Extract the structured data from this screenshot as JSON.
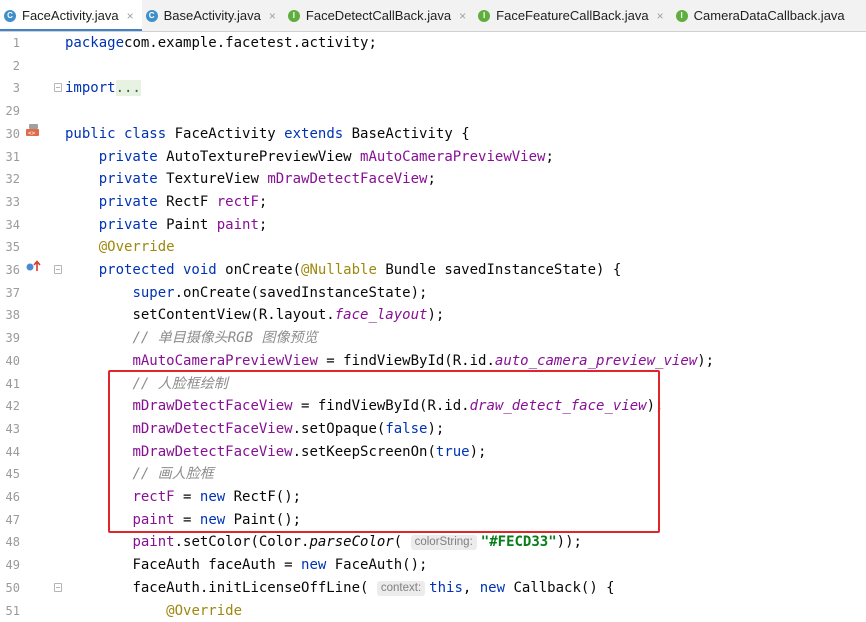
{
  "tabs": [
    {
      "label": "FaceActivity.java",
      "icon": "class-icon",
      "active": true,
      "close": "×"
    },
    {
      "label": "BaseActivity.java",
      "icon": "class-icon",
      "active": false,
      "close": "×"
    },
    {
      "label": "FaceDetectCallBack.java",
      "icon": "interface-icon",
      "active": false,
      "close": "×"
    },
    {
      "label": "FaceFeatureCallBack.java",
      "icon": "interface-icon",
      "active": false,
      "close": "×"
    },
    {
      "label": "CameraDataCallback.java",
      "icon": "interface-icon",
      "active": false,
      "close": ""
    }
  ],
  "tab_icon_letters": {
    "class": "C",
    "interface": "I"
  },
  "line_numbers": [
    "1",
    "2",
    "3",
    "29",
    "30",
    "31",
    "32",
    "33",
    "34",
    "35",
    "36",
    "37",
    "38",
    "39",
    "40",
    "41",
    "42",
    "43",
    "44",
    "45",
    "46",
    "47",
    "48",
    "49",
    "50",
    "51"
  ],
  "code_lines": [
    [
      [
        "kw",
        "package"
      ],
      [
        "",
        "com.example.facetest.activity;"
      ]
    ],
    [],
    [
      [
        "kw",
        "import"
      ],
      [
        "",
        ""
      ],
      [
        "fold-dots",
        "..."
      ]
    ],
    [],
    [
      [
        "kw",
        "public class"
      ],
      [
        "",
        " FaceActivity "
      ],
      [
        "kw",
        "extends"
      ],
      [
        "",
        " BaseActivity {"
      ]
    ],
    [
      [
        "",
        "    "
      ],
      [
        "kw",
        "private"
      ],
      [
        "",
        " AutoTexturePreviewView "
      ],
      [
        "fld",
        "mAutoCameraPreviewView"
      ],
      [
        "",
        ";"
      ]
    ],
    [
      [
        "",
        "    "
      ],
      [
        "kw",
        "private"
      ],
      [
        "",
        " TextureView "
      ],
      [
        "fld",
        "mDrawDetectFaceView"
      ],
      [
        "",
        ";"
      ]
    ],
    [
      [
        "",
        "    "
      ],
      [
        "kw",
        "private"
      ],
      [
        "",
        " RectF "
      ],
      [
        "fld",
        "rectF"
      ],
      [
        "",
        ";"
      ]
    ],
    [
      [
        "",
        "    "
      ],
      [
        "kw",
        "private"
      ],
      [
        "",
        " Paint "
      ],
      [
        "fld",
        "paint"
      ],
      [
        "",
        ";"
      ]
    ],
    [
      [
        "",
        "    "
      ],
      [
        "ann",
        "@Override"
      ]
    ],
    [
      [
        "",
        "    "
      ],
      [
        "kw",
        "protected void"
      ],
      [
        "",
        " onCreate("
      ],
      [
        "ann",
        "@Nullable"
      ],
      [
        "",
        " Bundle savedInstanceState) {"
      ]
    ],
    [
      [
        "",
        "        "
      ],
      [
        "kw",
        "super"
      ],
      [
        "",
        ".onCreate(savedInstanceState);"
      ]
    ],
    [
      [
        "",
        "        "
      ],
      [
        "",
        "setContentView(R.layout."
      ],
      [
        "ifld",
        "face_layout"
      ],
      [
        "",
        ");"
      ]
    ],
    [
      [
        "",
        "        "
      ],
      [
        "cmt",
        "// 单目摄像头RGB 图像预览"
      ]
    ],
    [
      [
        "",
        "        "
      ],
      [
        "fld",
        "mAutoCameraPreviewView"
      ],
      [
        "",
        " = findViewById(R.id."
      ],
      [
        "ifld",
        "auto_camera_preview_view"
      ],
      [
        "",
        ");"
      ]
    ],
    [
      [
        "",
        "        "
      ],
      [
        "cmt",
        "// 人脸框绘制"
      ]
    ],
    [
      [
        "",
        "        "
      ],
      [
        "fld",
        "mDrawDetectFaceView"
      ],
      [
        "",
        " = findViewById(R.id."
      ],
      [
        "ifld",
        "draw_detect_face_view"
      ],
      [
        "",
        ");"
      ]
    ],
    [
      [
        "",
        "        "
      ],
      [
        "fld",
        "mDrawDetectFaceView"
      ],
      [
        "",
        ".setOpaque("
      ],
      [
        "kw",
        "false"
      ],
      [
        "",
        ");"
      ]
    ],
    [
      [
        "",
        "        "
      ],
      [
        "fld",
        "mDrawDetectFaceView"
      ],
      [
        "",
        ".setKeepScreenOn("
      ],
      [
        "kw",
        "true"
      ],
      [
        "",
        ");"
      ]
    ],
    [
      [
        "",
        "        "
      ],
      [
        "cmt",
        "// 画人脸框"
      ]
    ],
    [
      [
        "",
        "        "
      ],
      [
        "fld",
        "rectF"
      ],
      [
        "",
        " = "
      ],
      [
        "kw",
        "new"
      ],
      [
        "",
        " RectF();"
      ]
    ],
    [
      [
        "",
        "        "
      ],
      [
        "fld",
        "paint"
      ],
      [
        "",
        " = "
      ],
      [
        "kw",
        "new"
      ],
      [
        "",
        " Paint();"
      ]
    ],
    [
      [
        "",
        "        "
      ],
      [
        "fld",
        "paint"
      ],
      [
        "",
        ".setColor(Color."
      ],
      [
        "ital",
        "parseColor"
      ],
      [
        "",
        "( "
      ],
      [
        "hint",
        "colorString:"
      ],
      [
        "str",
        "\"#FECD33\""
      ],
      [
        "",
        "));"
      ]
    ],
    [
      [
        "",
        "        "
      ],
      [
        "",
        "FaceAuth faceAuth = "
      ],
      [
        "kw",
        "new"
      ],
      [
        "",
        " FaceAuth();"
      ]
    ],
    [
      [
        "",
        "        "
      ],
      [
        "",
        "faceAuth.initLicenseOffLine( "
      ],
      [
        "hint",
        "context:"
      ],
      [
        "kw",
        "this"
      ],
      [
        "",
        ", "
      ],
      [
        "kw",
        "new"
      ],
      [
        "",
        " Callback() {"
      ]
    ],
    [
      [
        "",
        "            "
      ],
      [
        "ann",
        "@Override"
      ]
    ]
  ],
  "gutter_icons": {
    "line_30": "android-layout-icon",
    "line_36": "override-method-icon"
  },
  "colors": {
    "keyword": "#0033b3",
    "annotation": "#9e880d",
    "comment": "#8c8c8c",
    "field": "#871094",
    "string": "#067d17",
    "highlight_box": "#e0262b",
    "active_tab_underline": "#4083c9"
  }
}
